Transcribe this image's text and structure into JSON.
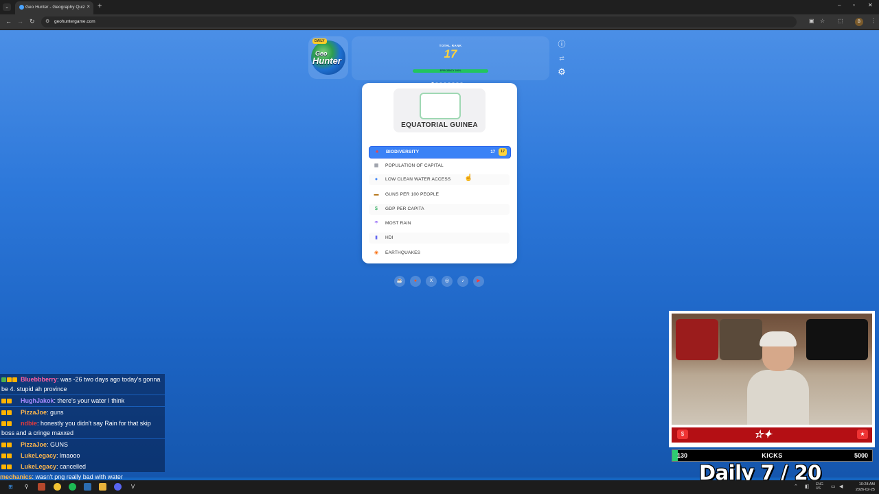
{
  "browser": {
    "tab_title": "Geo Hunter - Geography Quiz",
    "url": "geohuntergame.com"
  },
  "game": {
    "logo": {
      "badge": "DAILY",
      "line1": "Geo",
      "line2": "Hunter"
    },
    "rank_label": "TOTAL RANK",
    "rank_value": "17",
    "efficiency_label": "EFFICIENCY 100%",
    "efficiency_fraction": 1.0,
    "round_dots_total": 8,
    "round_dots_filled": 1,
    "country": "EQUATORIAL GUINEA",
    "categories": [
      {
        "label": "BIODIVERSITY",
        "icon": "leaf-icon",
        "glyph": "♣",
        "color": "#e5484d",
        "active": true,
        "rank": "17"
      },
      {
        "label": "POPULATION OF CAPITAL",
        "icon": "building-icon",
        "glyph": "▦",
        "color": "#6b7280"
      },
      {
        "label": "LOW CLEAN WATER ACCESS",
        "icon": "droplet-icon",
        "glyph": "●",
        "color": "#3b82f6"
      },
      {
        "label": "GUNS PER 100 PEOPLE",
        "icon": "gun-icon",
        "glyph": "▬",
        "color": "#b7791f"
      },
      {
        "label": "GDP PER CAPITA",
        "icon": "money-icon",
        "glyph": "$",
        "color": "#16a34a"
      },
      {
        "label": "MOST RAIN",
        "icon": "rain-icon",
        "glyph": "☂",
        "color": "#8b5cf6"
      },
      {
        "label": "HDI",
        "icon": "chart-icon",
        "glyph": "▮",
        "color": "#6366f1"
      },
      {
        "label": "EARTHQUAKES",
        "icon": "earthquake-icon",
        "glyph": "◉",
        "color": "#f97316"
      }
    ],
    "social": [
      {
        "name": "coffee-icon",
        "glyph": "☕"
      },
      {
        "name": "reddit-icon",
        "glyph": "●"
      },
      {
        "name": "x-icon",
        "glyph": "X"
      },
      {
        "name": "instagram-icon",
        "glyph": "◎"
      },
      {
        "name": "tiktok-icon",
        "glyph": "♪"
      },
      {
        "name": "youtube-icon",
        "glyph": "▶"
      }
    ]
  },
  "chat": [
    {
      "user": "Bluebbberry",
      "color": "#ff5fa2",
      "text": ": was -26 two days ago today's gonna be 4. stupid ah province"
    },
    {
      "user": "HughJakok",
      "color": "#a98cff",
      "text": ": there's your water I think"
    },
    {
      "user": "PizzaJoe",
      "color": "#ffb84d",
      "text": ": guns"
    },
    {
      "user": "ndbie",
      "color": "#e33b3b",
      "text": ": honestly you didn't say Rain for that skip boss and a cringe maxxed"
    },
    {
      "user": "PizzaJoe",
      "color": "#ffb84d",
      "text": ": GUNS"
    },
    {
      "user": "LukeLegacy",
      "color": "#ffb84d",
      "text": ": lmaooo"
    },
    {
      "user": "LukeLegacy",
      "color": "#ffb84d",
      "text": ": cancelled"
    },
    {
      "user": "mechanics",
      "color": "#ffb84d",
      "text": ": wasn't png really bad with water"
    }
  ],
  "stream": {
    "kicks_current": "130",
    "kicks_label": "KICKS",
    "kicks_goal": "5000",
    "kicks_fraction": 0.026,
    "daily_text": "Daily  7 / 20"
  },
  "taskbar": {
    "time": "10:28 AM",
    "date": "2026-02-25",
    "lang": "ENG US"
  }
}
